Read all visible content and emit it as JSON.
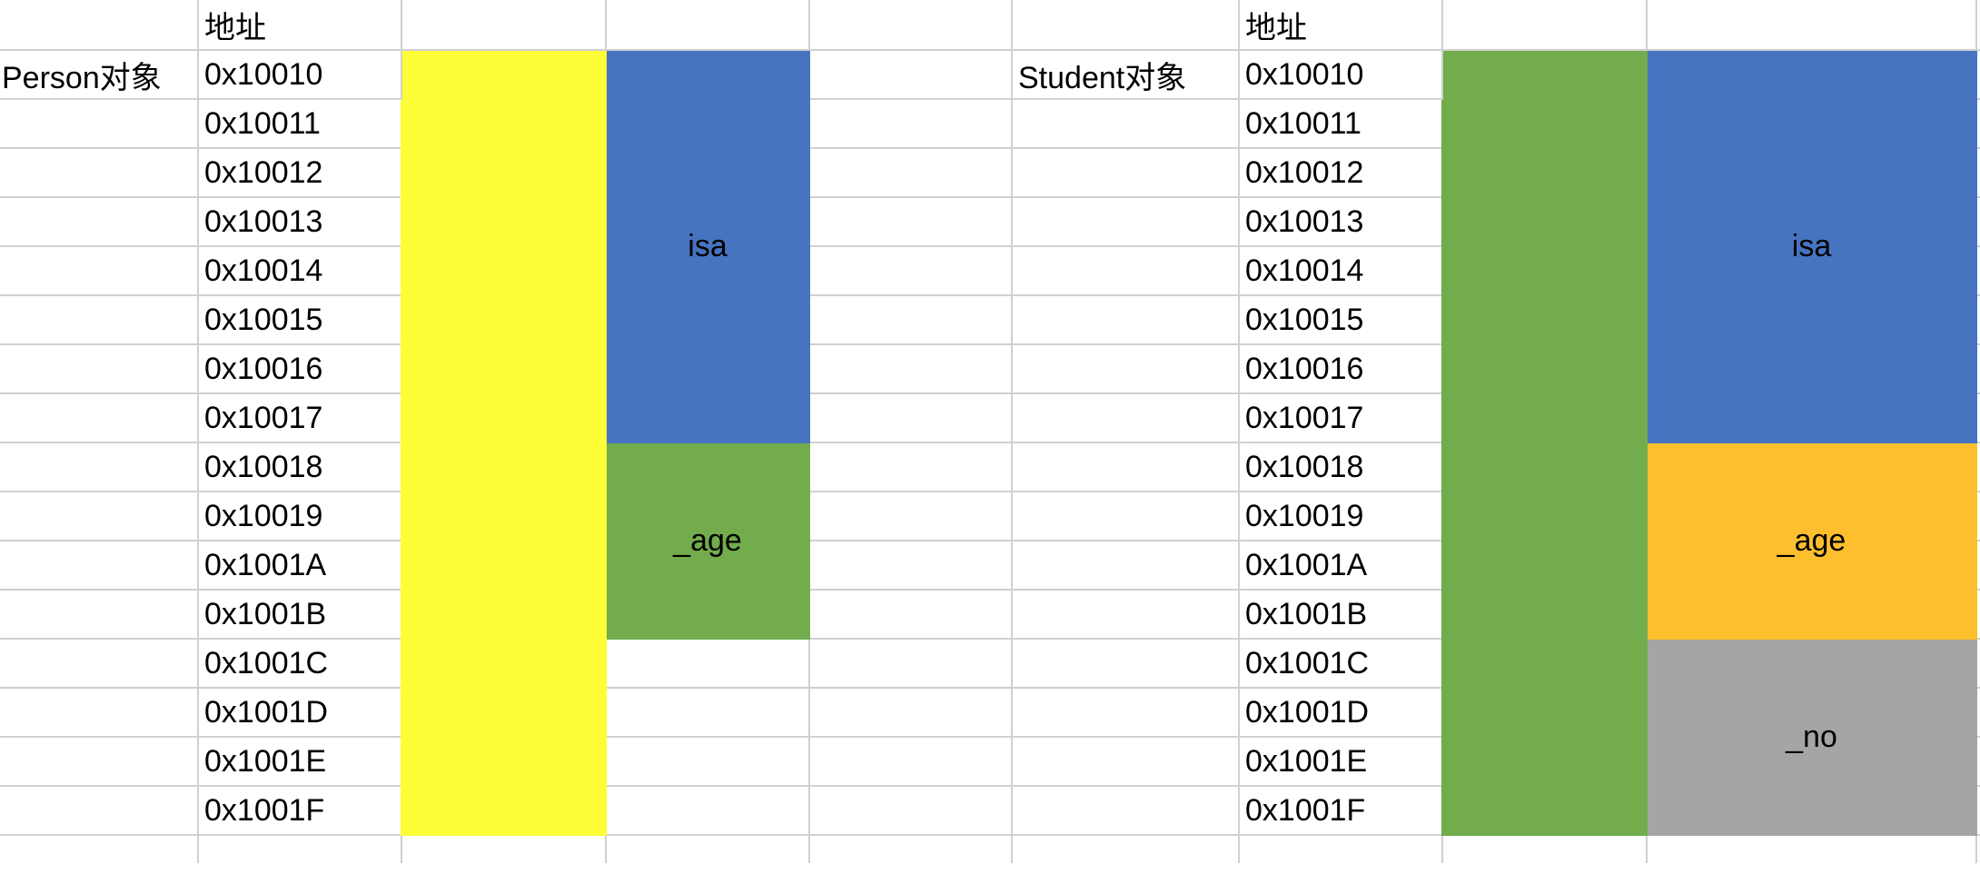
{
  "header": {
    "address": "地址"
  },
  "person": {
    "label": "Person对象",
    "fields": {
      "isa": "isa",
      "age": "_age"
    }
  },
  "student": {
    "label": "Student对象",
    "fields": {
      "isa": "isa",
      "age": "_age",
      "no": "_no"
    }
  },
  "addresses": [
    "0x10010",
    "0x10011",
    "0x10012",
    "0x10013",
    "0x10014",
    "0x10015",
    "0x10016",
    "0x10017",
    "0x10018",
    "0x10019",
    "0x1001A",
    "0x1001B",
    "0x1001C",
    "0x1001D",
    "0x1001E",
    "0x1001F"
  ],
  "colors": {
    "person_object": "#FDFD38",
    "person_isa": "#4674C1",
    "person_age": "#72AC4D",
    "student_object": "#72AC4D",
    "student_isa": "#4674C1",
    "student_age": "#FDBF2D",
    "student_no": "#A5A5A5"
  }
}
